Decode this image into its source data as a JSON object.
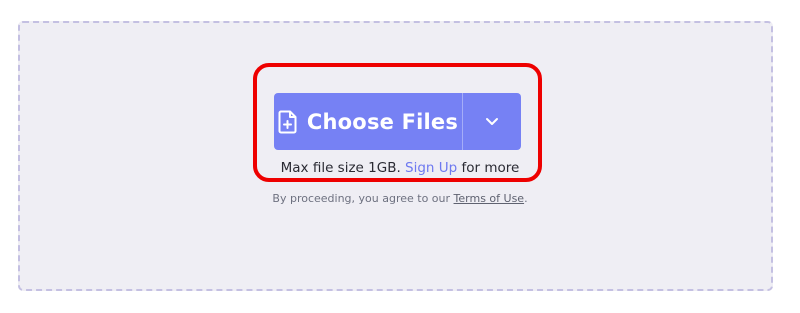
{
  "upload": {
    "choose_label": "Choose Files",
    "max_size_prefix": "Max file size 1GB.",
    "signup_link": "Sign Up",
    "max_size_suffix": "for more",
    "terms_prefix": "By proceeding, you agree to our",
    "terms_link": "Terms of Use",
    "terms_suffix": "."
  },
  "icons": {
    "file_add": "file-plus-icon",
    "dropdown": "chevron-down-icon"
  },
  "colors": {
    "button": "#7681f4",
    "highlight": "#ee0000",
    "dropzone_bg": "#efeef4",
    "dropzone_border": "#c4c0e2",
    "link": "#6e79f0"
  }
}
